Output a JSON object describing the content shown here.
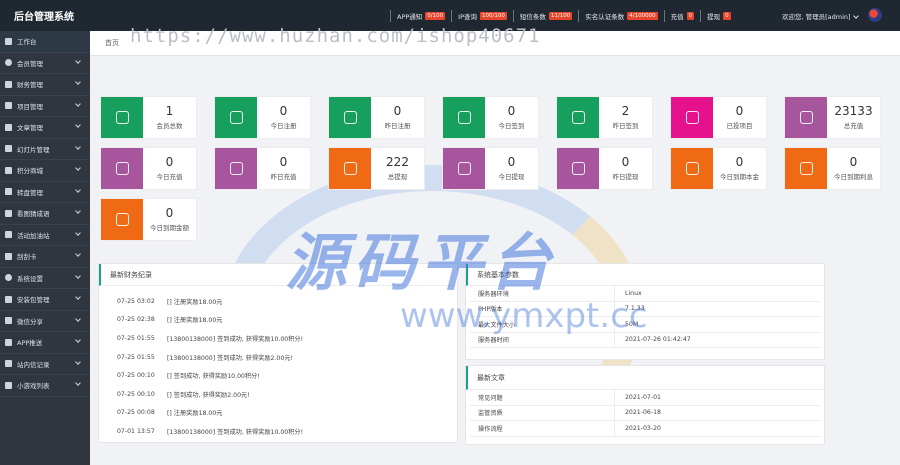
{
  "app": {
    "title": "后台管理系统"
  },
  "top_stats": [
    {
      "label": "APP通知",
      "badge": "0/100"
    },
    {
      "label": "IP查询",
      "badge": "100/100"
    },
    {
      "label": "短信条数",
      "badge": "11/100"
    },
    {
      "label": "实名认证条数",
      "badge": "4/100000"
    },
    {
      "label": "充值",
      "badge": "0"
    },
    {
      "label": "提现",
      "badge": "0"
    }
  ],
  "user": {
    "welcome": "欢迎您, 管理员[admin]"
  },
  "sidebar": [
    {
      "label": "工作台",
      "icon": "grid-icon"
    },
    {
      "label": "会员管理",
      "icon": "user-icon"
    },
    {
      "label": "财务管理",
      "icon": "money-icon"
    },
    {
      "label": "项目管理",
      "icon": "project-icon"
    },
    {
      "label": "文章管理",
      "icon": "article-icon"
    },
    {
      "label": "幻灯片管理",
      "icon": "slides-icon"
    },
    {
      "label": "积分商城",
      "icon": "shop-icon"
    },
    {
      "label": "转盘管理",
      "icon": "wheel-icon"
    },
    {
      "label": "看图猜成语",
      "icon": "puzzle-icon"
    },
    {
      "label": "活动加油站",
      "icon": "activity-icon"
    },
    {
      "label": "刮刮卡",
      "icon": "card-icon"
    },
    {
      "label": "系统设置",
      "icon": "gear-icon"
    },
    {
      "label": "安装包管理",
      "icon": "package-icon"
    },
    {
      "label": "微信分享",
      "icon": "share-icon"
    },
    {
      "label": "APP推送",
      "icon": "push-icon"
    },
    {
      "label": "站内信记录",
      "icon": "mail-icon"
    },
    {
      "label": "小游戏列表",
      "icon": "game-icon"
    }
  ],
  "breadcrumb": {
    "home": "首页"
  },
  "watermark": {
    "url": "https://www.huzhan.com/ishop40671",
    "brand": "源码平台",
    "domain": "www.ymxpt.cc"
  },
  "stat_cards": [
    {
      "value": "1",
      "label": "会员总数",
      "color": "#17a05d",
      "icon": "user-icon"
    },
    {
      "value": "0",
      "label": "今日注册",
      "color": "#17a05d",
      "icon": "user-icon"
    },
    {
      "value": "0",
      "label": "昨日注册",
      "color": "#17a05d",
      "icon": "user-icon"
    },
    {
      "value": "0",
      "label": "今日签到",
      "color": "#17a05d",
      "icon": "user-icon"
    },
    {
      "value": "2",
      "label": "昨日签到",
      "color": "#17a05d",
      "icon": "user-icon"
    },
    {
      "value": "0",
      "label": "已投项目",
      "color": "#e6118c",
      "icon": "document-icon"
    },
    {
      "value": "23133",
      "label": "总充值",
      "color": "#a7569e",
      "icon": "edit-icon"
    },
    {
      "value": "0",
      "label": "今日充值",
      "color": "#a7569e",
      "icon": "edit-icon"
    },
    {
      "value": "0",
      "label": "昨日充值",
      "color": "#a7569e",
      "icon": "edit-icon"
    },
    {
      "value": "222",
      "label": "总提现",
      "color": "#f06a16",
      "icon": "money-bag-icon"
    },
    {
      "value": "0",
      "label": "今日提现",
      "color": "#a7569e",
      "icon": "edit-icon"
    },
    {
      "value": "0",
      "label": "昨日提现",
      "color": "#a7569e",
      "icon": "edit-icon"
    },
    {
      "value": "0",
      "label": "今日到期本金",
      "color": "#f06a16",
      "icon": "money-bag-icon"
    },
    {
      "value": "0",
      "label": "今日到期利息",
      "color": "#f06a16",
      "icon": "money-bag-icon"
    },
    {
      "value": "0",
      "label": "今日到期金额",
      "color": "#f06a16",
      "icon": "money-bag-icon"
    }
  ],
  "finance_panel": {
    "title": "最新财务纪录",
    "rows": [
      {
        "time": "07-25 03:02",
        "text": "[] 注册奖励18.00元"
      },
      {
        "time": "07-25 02:38",
        "text": "[] 注册奖励18.00元"
      },
      {
        "time": "07-25 01:55",
        "text": "[13800138000] 签到成功, 获得奖励10.00积分!"
      },
      {
        "time": "07-25 01:55",
        "text": "[13800138000] 签到成功, 获得奖励2.00元!"
      },
      {
        "time": "07-25 00:10",
        "text": "[] 签到成功, 获得奖励10.00积分!"
      },
      {
        "time": "07-25 00:10",
        "text": "[] 签到成功, 获得奖励2.00元!"
      },
      {
        "time": "07-25 00:08",
        "text": "[] 注册奖励18.00元"
      },
      {
        "time": "07-01 13:57",
        "text": "[13800138000] 签到成功, 获得奖励10.00积分!"
      }
    ]
  },
  "system_panel": {
    "title": "系统基本参数",
    "rows": [
      {
        "key": "服务器环境",
        "value": "Linux"
      },
      {
        "key": "PHP版本",
        "value": "7.1.33"
      },
      {
        "key": "最大文件大小",
        "value": "50M"
      },
      {
        "key": "服务器时间",
        "value": "2021-07-26 01:42:47"
      }
    ]
  },
  "articles_panel": {
    "title": "最新文章",
    "rows": [
      {
        "key": "常见问题",
        "value": "2021-07-01"
      },
      {
        "key": "监管资质",
        "value": "2021-06-18"
      },
      {
        "key": "操作流程",
        "value": "2021-03-20"
      }
    ]
  }
}
